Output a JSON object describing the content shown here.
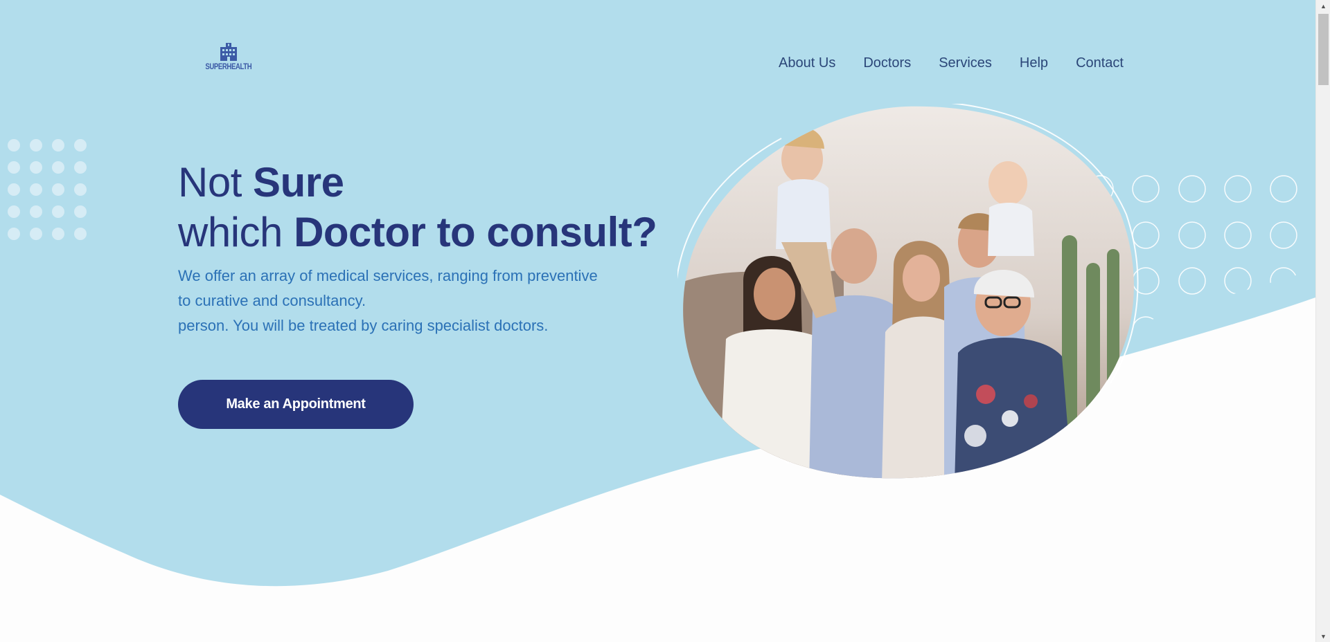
{
  "brand": {
    "logo_text": "SUPERHEALTH"
  },
  "nav": {
    "items": [
      {
        "label": "About Us"
      },
      {
        "label": "Doctors"
      },
      {
        "label": "Services"
      },
      {
        "label": "Help"
      },
      {
        "label": "Contact"
      }
    ]
  },
  "hero": {
    "title_line1_light": "Not ",
    "title_line1_bold": "Sure",
    "title_line2_light": "which ",
    "title_line2_bold": "Doctor to consult?",
    "description_line1": "We offer an array of medical services, ranging from preventive",
    "description_line2": "to curative and consultancy.",
    "description_line3": "person. You will be treated by caring specialist doctors.",
    "cta_label": "Make an Appointment"
  },
  "colors": {
    "hero_bg": "#b2ddec",
    "navy": "#27357a",
    "link": "#2b4678",
    "body_text": "#2b71b6",
    "white": "#fdfdfd"
  },
  "icons": {
    "logo": "hospital-building-icon",
    "scroll_up": "triangle-up-icon",
    "scroll_down": "triangle-down-icon"
  }
}
